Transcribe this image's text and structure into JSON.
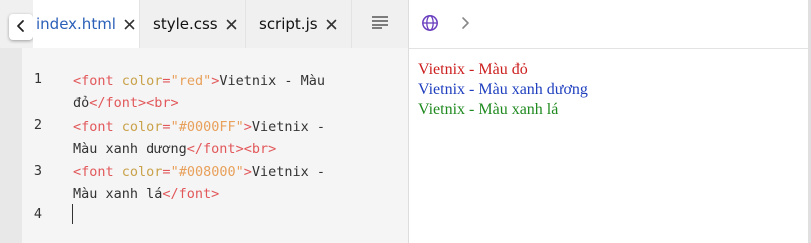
{
  "tabs": [
    {
      "label": "index.html",
      "active": true
    },
    {
      "label": "style.css",
      "active": false
    },
    {
      "label": "script.js",
      "active": false
    }
  ],
  "icons": {
    "back": "chevron-left-icon",
    "close": "close-icon",
    "outline": "align-lines-icon",
    "globe": "globe-icon",
    "forward": "chevron-right-icon"
  },
  "editor": {
    "line_numbers": [
      "1",
      "2",
      "3",
      "4"
    ],
    "lines": [
      {
        "t1": "<font ",
        "a": "color",
        "eq": "=",
        "s": "\"red\"",
        "t2": ">",
        "x": "Vietnix - Màu"
      },
      {
        "x": "đỏ",
        "t3": "</font><br>"
      },
      {
        "t1": "<font ",
        "a": "color",
        "eq": "=",
        "s": "\"#0000FF\"",
        "t2": ">",
        "x": "Vietnix -"
      },
      {
        "x": "Màu xanh dương",
        "t3": "</font><br>"
      },
      {
        "t1": "<font ",
        "a": "color",
        "eq": "=",
        "s": "\"#008000\"",
        "t2": ">",
        "x": "Vietnix -"
      },
      {
        "x": "Màu xanh lá",
        "t3": "</font>"
      }
    ]
  },
  "preview": {
    "lines": [
      {
        "text": "Vietnix - Màu đỏ",
        "color": "#cc1f1f"
      },
      {
        "text": "Vietnix - Màu xanh dương",
        "color": "#1f3fbf"
      },
      {
        "text": "Vietnix - Màu xanh lá",
        "color": "#1f8a1f"
      }
    ]
  },
  "colors": {
    "tag": "#e2585a",
    "attribute": "#c9a24a",
    "string": "#e8a05a",
    "active_tab_text": "#2b5fb8",
    "globe_icon": "#6a3fbf"
  }
}
